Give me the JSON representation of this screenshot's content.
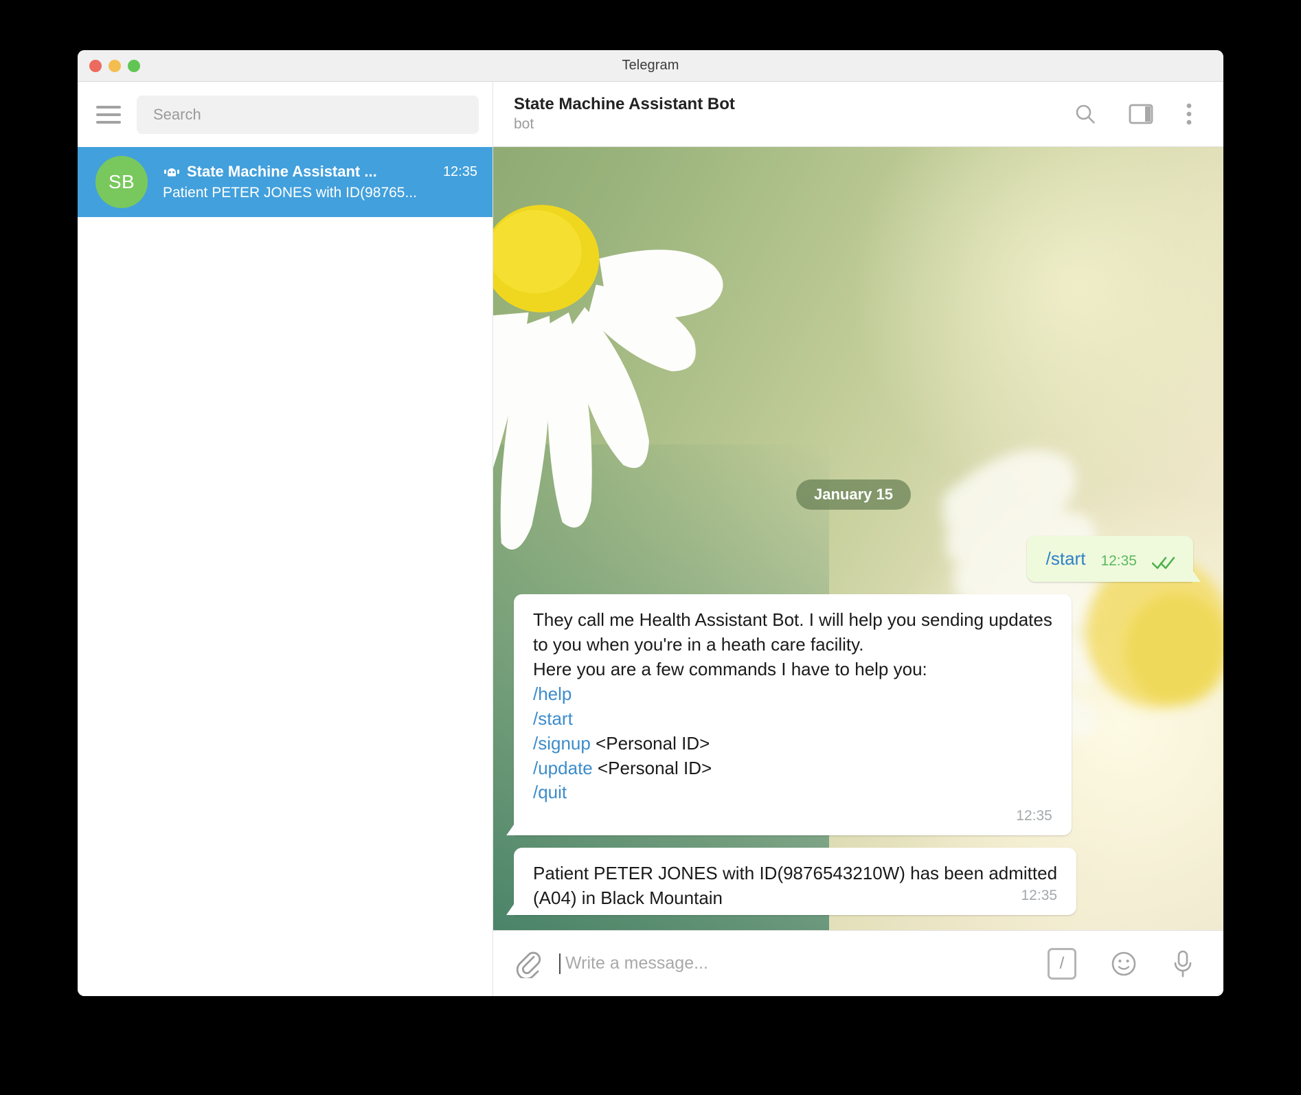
{
  "window": {
    "title": "Telegram",
    "traffic_lights": [
      {
        "name": "close",
        "color": "#ec6a5e"
      },
      {
        "name": "minimize",
        "color": "#f4bd4f"
      },
      {
        "name": "maximize",
        "color": "#61c554"
      }
    ]
  },
  "sidebar": {
    "menu_icon": "hamburger-icon",
    "search": {
      "placeholder": "Search",
      "value": ""
    },
    "chats": [
      {
        "avatar_initials": "SB",
        "avatar_color": "#79c85d",
        "badge_icon": "bot-icon",
        "name": "State Machine Assistant ...",
        "time": "12:35",
        "preview": "Patient PETER JONES with ID(98765...",
        "selected": true,
        "selected_color": "#42a0dc"
      }
    ]
  },
  "chat": {
    "header": {
      "title": "State Machine Assistant Bot",
      "subtitle": "bot",
      "actions": [
        {
          "icon": "search-icon",
          "label": "Search"
        },
        {
          "icon": "split-panel-icon",
          "label": "Toggle info panel"
        },
        {
          "icon": "more-vertical-icon",
          "label": "More"
        }
      ]
    },
    "date_divider": "January 15",
    "messages": [
      {
        "direction": "out",
        "command": "/start",
        "time": "12:35",
        "status_icon": "double-check-icon"
      },
      {
        "direction": "in",
        "lines": [
          {
            "text": "They call me Health Assistant Bot. I will help you sending updates",
            "type": "plain"
          },
          {
            "text": "to you when you're in a heath care facility.",
            "type": "plain"
          },
          {
            "text": "Here you are a few commands I have to help you:",
            "type": "plain"
          },
          {
            "link": "/help",
            "rest": "",
            "type": "command"
          },
          {
            "link": "/start",
            "rest": "",
            "type": "command"
          },
          {
            "link": "/signup",
            "rest": " <Personal ID>",
            "type": "command"
          },
          {
            "link": "/update",
            "rest": " <Personal ID>",
            "type": "command"
          },
          {
            "link": "/quit",
            "rest": "",
            "type": "command"
          }
        ],
        "time": "12:35"
      },
      {
        "direction": "in",
        "lines": [
          {
            "text": "Patient PETER JONES with ID(9876543210W) has been admitted",
            "type": "plain"
          },
          {
            "text": "(A04) in Black Mountain",
            "type": "plain"
          }
        ],
        "time": "12:35"
      }
    ],
    "composer": {
      "attach_icon": "paperclip-icon",
      "placeholder": "Write a message...",
      "value": "",
      "command_button": "/",
      "emoji_icon": "smiley-icon",
      "mic_icon": "microphone-icon"
    }
  },
  "colors": {
    "accent_blue": "#42a0dc",
    "link_blue": "#3c8ccb",
    "out_bubble": "#effadd",
    "out_time_green": "#5bb85b",
    "avatar_green": "#79c85d"
  }
}
